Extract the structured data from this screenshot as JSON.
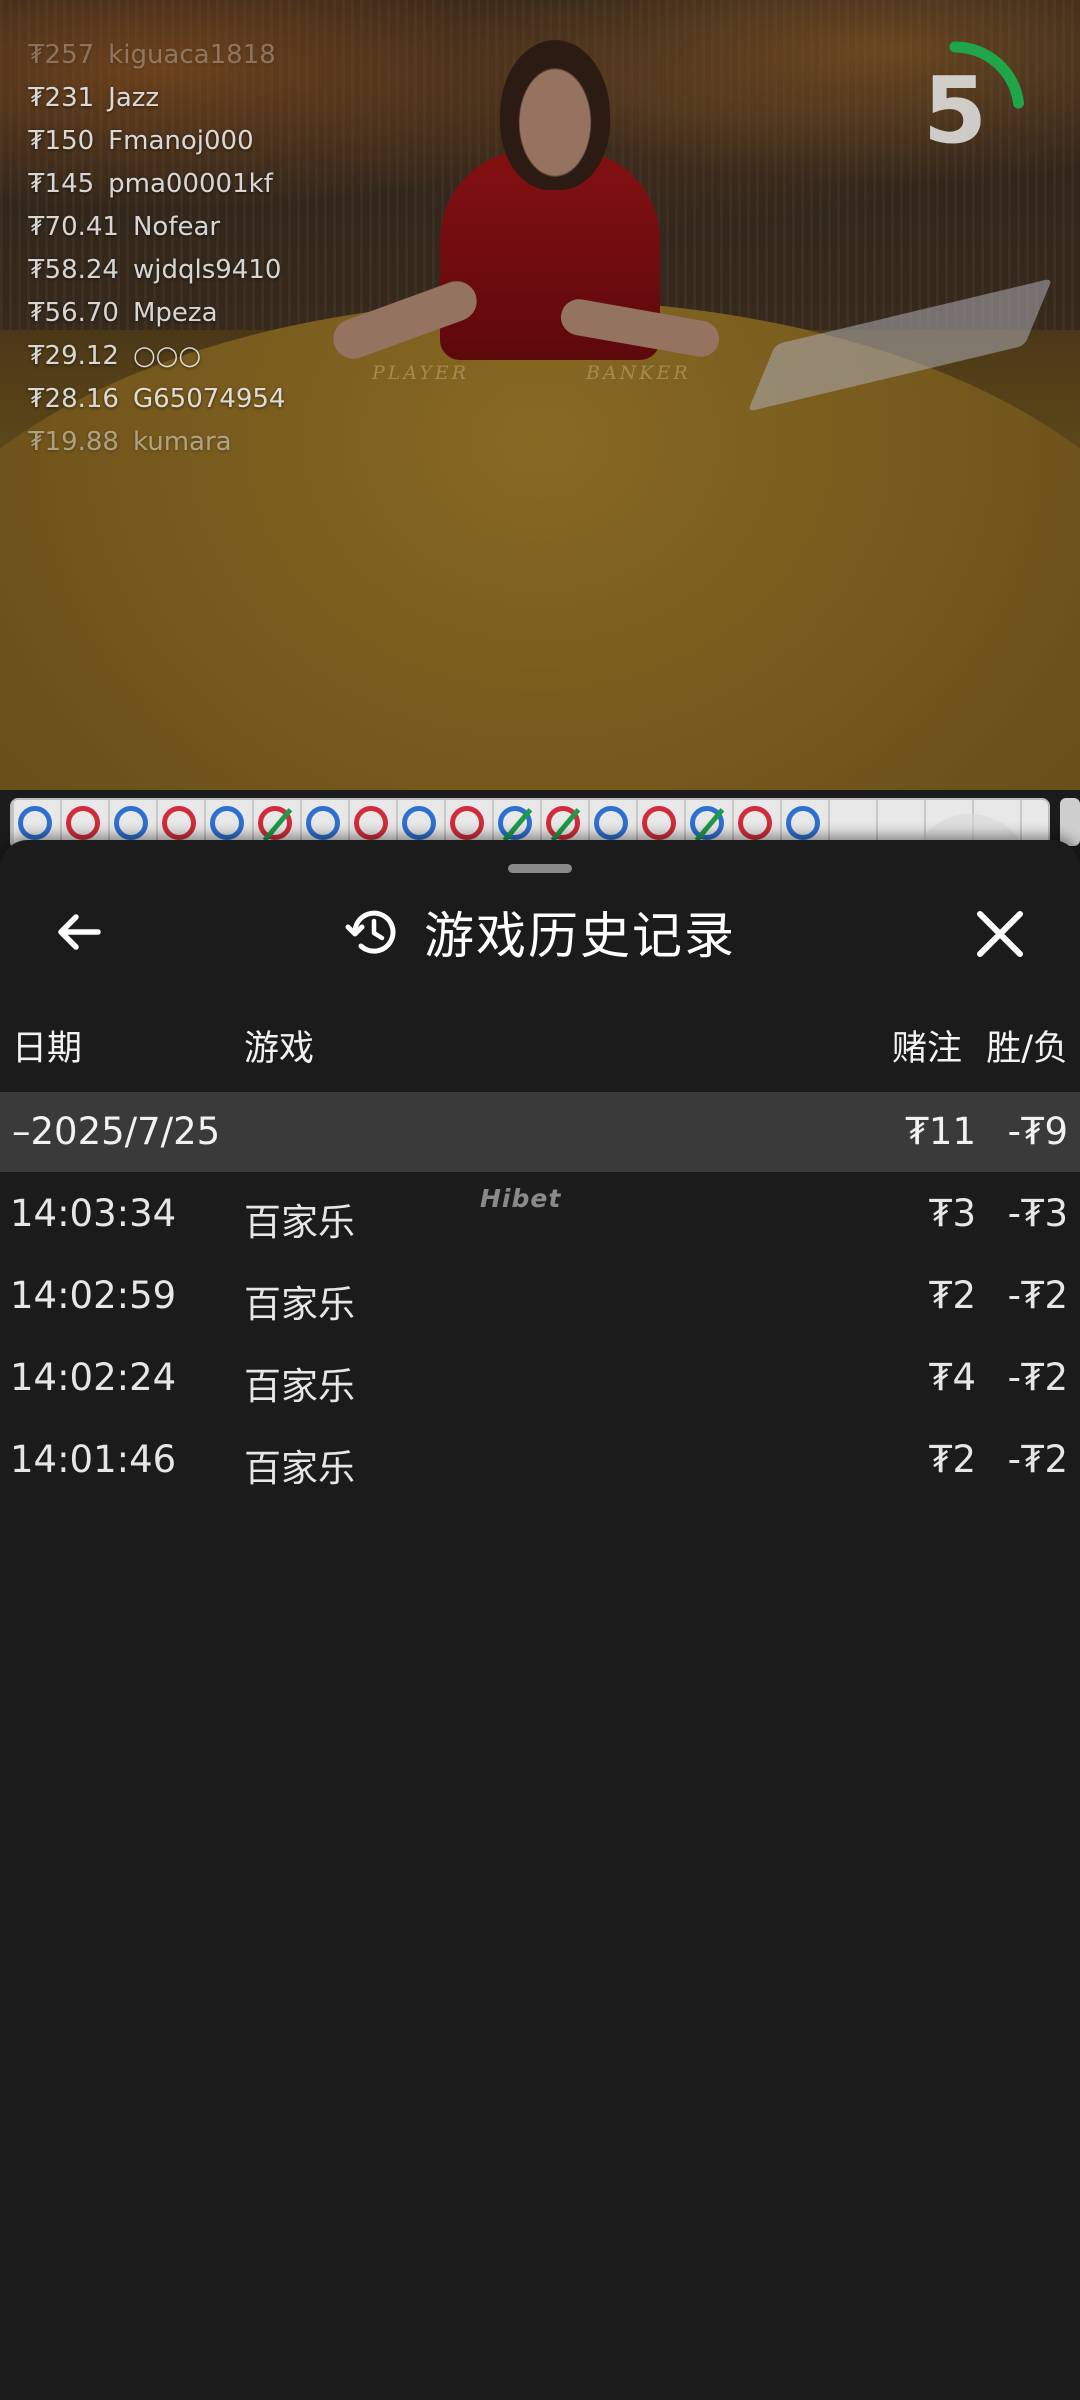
{
  "video": {
    "table_labels": {
      "player": "PLAYER",
      "banker": "BANKER"
    },
    "countdown": {
      "value": "5",
      "accent": "#1fa64a",
      "progress": 0.23
    },
    "winners": [
      {
        "amount": "₮257",
        "name": "kiguaca1818"
      },
      {
        "amount": "₮231",
        "name": "Jazz"
      },
      {
        "amount": "₮150",
        "name": "Fmanoj000"
      },
      {
        "amount": "₮145",
        "name": "pma00001kf"
      },
      {
        "amount": "₮70.41",
        "name": "Nofear"
      },
      {
        "amount": "₮58.24",
        "name": "wjdqls9410"
      },
      {
        "amount": "₮56.70",
        "name": "Mpeza"
      },
      {
        "amount": "₮29.12",
        "name": "○○○"
      },
      {
        "amount": "₮28.16",
        "name": "G65074954"
      },
      {
        "amount": "₮19.88",
        "name": "kumara"
      }
    ],
    "road": {
      "colors": {
        "player": "#2e6fd0",
        "banker": "#cf2d3b",
        "tie": "#1e9a4a"
      },
      "beads": [
        "p",
        "b",
        "p",
        "b",
        "p",
        "b-tie",
        "p",
        "b",
        "p",
        "b",
        "p-tie",
        "b-tie",
        "p",
        "b",
        "p-tie",
        "b",
        "p"
      ]
    }
  },
  "sheet": {
    "title": "游戏历史记录",
    "icons": {
      "back": "back-arrow-icon",
      "history": "history-icon",
      "close": "close-icon"
    },
    "columns": {
      "date": "日期",
      "game": "游戏",
      "bet": "赌注",
      "result": "胜/负"
    },
    "date_group": {
      "label": "–2025/7/25",
      "bet": "₮11",
      "result": "-₮9"
    },
    "watermark": "Hibet",
    "rows": [
      {
        "time": "14:03:34",
        "game": "百家乐",
        "bet": "₮3",
        "result": "-₮3"
      },
      {
        "time": "14:02:59",
        "game": "百家乐",
        "bet": "₮2",
        "result": "-₮2"
      },
      {
        "time": "14:02:24",
        "game": "百家乐",
        "bet": "₮4",
        "result": "-₮2"
      },
      {
        "time": "14:01:46",
        "game": "百家乐",
        "bet": "₮2",
        "result": "-₮2"
      }
    ]
  }
}
